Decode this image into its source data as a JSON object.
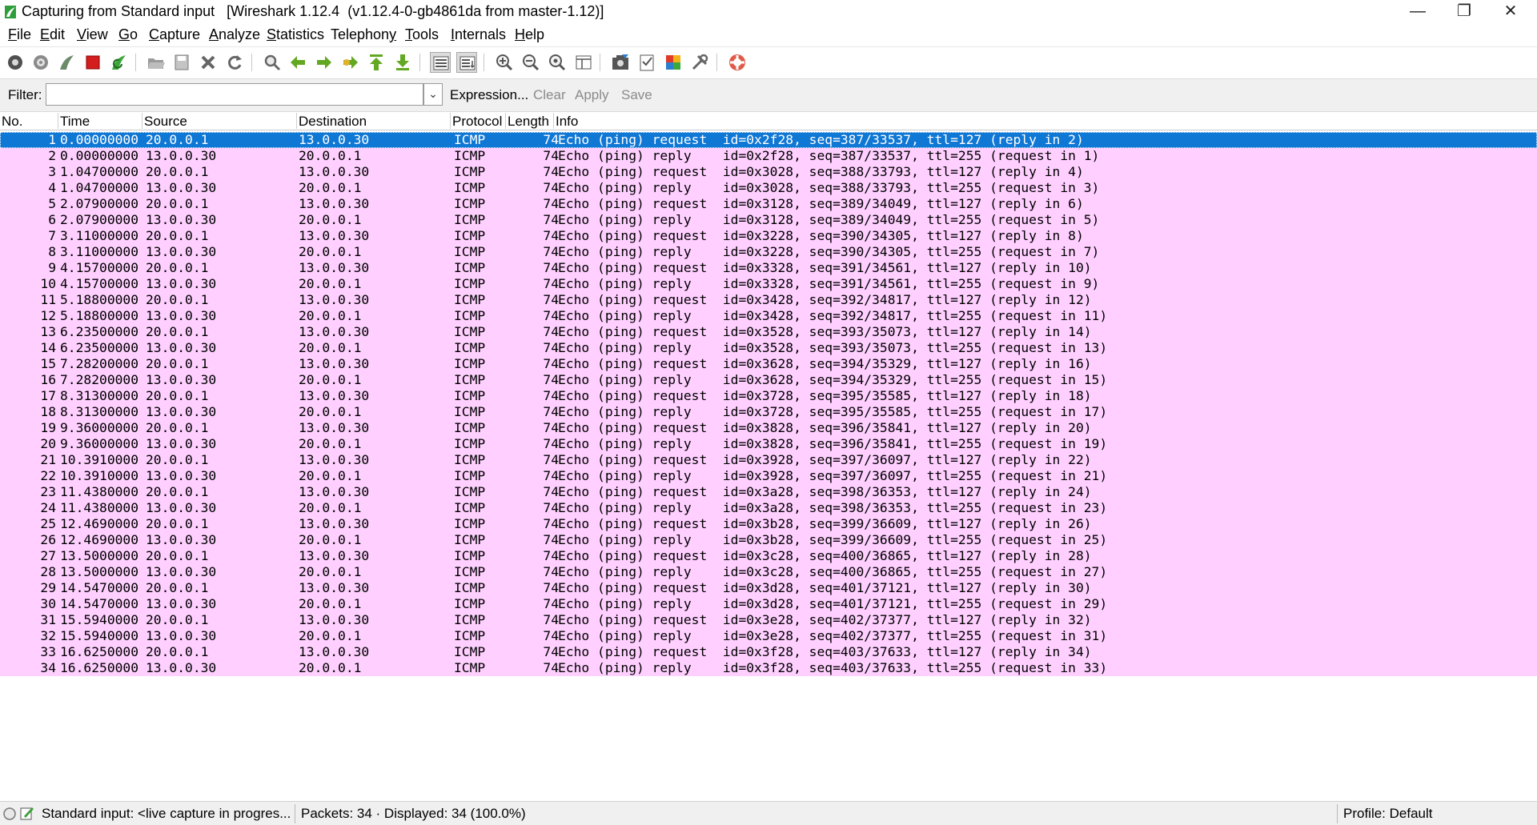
{
  "window": {
    "title": "Capturing from Standard input   [Wireshark 1.12.4  (v1.12.4-0-gb4861da from master-1.12)]",
    "minimize_glyph": "—",
    "restore_glyph": "❐",
    "close_glyph": "✕"
  },
  "menu": [
    {
      "pre": "",
      "key": "F",
      "post": "ile"
    },
    {
      "pre": "",
      "key": "E",
      "post": "dit"
    },
    {
      "pre": "",
      "key": "V",
      "post": "iew"
    },
    {
      "pre": "",
      "key": "G",
      "post": "o"
    },
    {
      "pre": "",
      "key": "C",
      "post": "apture"
    },
    {
      "pre": "",
      "key": "A",
      "post": "nalyze"
    },
    {
      "pre": "",
      "key": "S",
      "post": "tatistics"
    },
    {
      "pre": "Telephon",
      "key": "y",
      "post": ""
    },
    {
      "pre": "",
      "key": "T",
      "post": "ools"
    },
    {
      "pre": "",
      "key": "I",
      "post": "nternals"
    },
    {
      "pre": "",
      "key": "H",
      "post": "elp"
    }
  ],
  "filter": {
    "label": "Filter:",
    "value": "",
    "expression": "Expression...",
    "clear": "Clear",
    "apply": "Apply",
    "save": "Save"
  },
  "columns": {
    "no": "No.",
    "time": "Time",
    "source": "Source",
    "destination": "Destination",
    "protocol": "Protocol",
    "length": "Length",
    "info": "Info"
  },
  "packets": [
    {
      "no": "1",
      "time": "0.00000000",
      "src": "20.0.0.1",
      "dst": "13.0.0.30",
      "proto": "ICMP",
      "len": "74",
      "info": "Echo (ping) request  id=0x2f28, seq=387/33537, ttl=127 (reply in 2)"
    },
    {
      "no": "2",
      "time": "0.00000000",
      "src": "13.0.0.30",
      "dst": "20.0.0.1",
      "proto": "ICMP",
      "len": "74",
      "info": "Echo (ping) reply    id=0x2f28, seq=387/33537, ttl=255 (request in 1)"
    },
    {
      "no": "3",
      "time": "1.04700000",
      "src": "20.0.0.1",
      "dst": "13.0.0.30",
      "proto": "ICMP",
      "len": "74",
      "info": "Echo (ping) request  id=0x3028, seq=388/33793, ttl=127 (reply in 4)"
    },
    {
      "no": "4",
      "time": "1.04700000",
      "src": "13.0.0.30",
      "dst": "20.0.0.1",
      "proto": "ICMP",
      "len": "74",
      "info": "Echo (ping) reply    id=0x3028, seq=388/33793, ttl=255 (request in 3)"
    },
    {
      "no": "5",
      "time": "2.07900000",
      "src": "20.0.0.1",
      "dst": "13.0.0.30",
      "proto": "ICMP",
      "len": "74",
      "info": "Echo (ping) request  id=0x3128, seq=389/34049, ttl=127 (reply in 6)"
    },
    {
      "no": "6",
      "time": "2.07900000",
      "src": "13.0.0.30",
      "dst": "20.0.0.1",
      "proto": "ICMP",
      "len": "74",
      "info": "Echo (ping) reply    id=0x3128, seq=389/34049, ttl=255 (request in 5)"
    },
    {
      "no": "7",
      "time": "3.11000000",
      "src": "20.0.0.1",
      "dst": "13.0.0.30",
      "proto": "ICMP",
      "len": "74",
      "info": "Echo (ping) request  id=0x3228, seq=390/34305, ttl=127 (reply in 8)"
    },
    {
      "no": "8",
      "time": "3.11000000",
      "src": "13.0.0.30",
      "dst": "20.0.0.1",
      "proto": "ICMP",
      "len": "74",
      "info": "Echo (ping) reply    id=0x3228, seq=390/34305, ttl=255 (request in 7)"
    },
    {
      "no": "9",
      "time": "4.15700000",
      "src": "20.0.0.1",
      "dst": "13.0.0.30",
      "proto": "ICMP",
      "len": "74",
      "info": "Echo (ping) request  id=0x3328, seq=391/34561, ttl=127 (reply in 10)"
    },
    {
      "no": "10",
      "time": "4.15700000",
      "src": "13.0.0.30",
      "dst": "20.0.0.1",
      "proto": "ICMP",
      "len": "74",
      "info": "Echo (ping) reply    id=0x3328, seq=391/34561, ttl=255 (request in 9)"
    },
    {
      "no": "11",
      "time": "5.18800000",
      "src": "20.0.0.1",
      "dst": "13.0.0.30",
      "proto": "ICMP",
      "len": "74",
      "info": "Echo (ping) request  id=0x3428, seq=392/34817, ttl=127 (reply in 12)"
    },
    {
      "no": "12",
      "time": "5.18800000",
      "src": "13.0.0.30",
      "dst": "20.0.0.1",
      "proto": "ICMP",
      "len": "74",
      "info": "Echo (ping) reply    id=0x3428, seq=392/34817, ttl=255 (request in 11)"
    },
    {
      "no": "13",
      "time": "6.23500000",
      "src": "20.0.0.1",
      "dst": "13.0.0.30",
      "proto": "ICMP",
      "len": "74",
      "info": "Echo (ping) request  id=0x3528, seq=393/35073, ttl=127 (reply in 14)"
    },
    {
      "no": "14",
      "time": "6.23500000",
      "src": "13.0.0.30",
      "dst": "20.0.0.1",
      "proto": "ICMP",
      "len": "74",
      "info": "Echo (ping) reply    id=0x3528, seq=393/35073, ttl=255 (request in 13)"
    },
    {
      "no": "15",
      "time": "7.28200000",
      "src": "20.0.0.1",
      "dst": "13.0.0.30",
      "proto": "ICMP",
      "len": "74",
      "info": "Echo (ping) request  id=0x3628, seq=394/35329, ttl=127 (reply in 16)"
    },
    {
      "no": "16",
      "time": "7.28200000",
      "src": "13.0.0.30",
      "dst": "20.0.0.1",
      "proto": "ICMP",
      "len": "74",
      "info": "Echo (ping) reply    id=0x3628, seq=394/35329, ttl=255 (request in 15)"
    },
    {
      "no": "17",
      "time": "8.31300000",
      "src": "20.0.0.1",
      "dst": "13.0.0.30",
      "proto": "ICMP",
      "len": "74",
      "info": "Echo (ping) request  id=0x3728, seq=395/35585, ttl=127 (reply in 18)"
    },
    {
      "no": "18",
      "time": "8.31300000",
      "src": "13.0.0.30",
      "dst": "20.0.0.1",
      "proto": "ICMP",
      "len": "74",
      "info": "Echo (ping) reply    id=0x3728, seq=395/35585, ttl=255 (request in 17)"
    },
    {
      "no": "19",
      "time": "9.36000000",
      "src": "20.0.0.1",
      "dst": "13.0.0.30",
      "proto": "ICMP",
      "len": "74",
      "info": "Echo (ping) request  id=0x3828, seq=396/35841, ttl=127 (reply in 20)"
    },
    {
      "no": "20",
      "time": "9.36000000",
      "src": "13.0.0.30",
      "dst": "20.0.0.1",
      "proto": "ICMP",
      "len": "74",
      "info": "Echo (ping) reply    id=0x3828, seq=396/35841, ttl=255 (request in 19)"
    },
    {
      "no": "21",
      "time": "10.3910000",
      "src": "20.0.0.1",
      "dst": "13.0.0.30",
      "proto": "ICMP",
      "len": "74",
      "info": "Echo (ping) request  id=0x3928, seq=397/36097, ttl=127 (reply in 22)"
    },
    {
      "no": "22",
      "time": "10.3910000",
      "src": "13.0.0.30",
      "dst": "20.0.0.1",
      "proto": "ICMP",
      "len": "74",
      "info": "Echo (ping) reply    id=0x3928, seq=397/36097, ttl=255 (request in 21)"
    },
    {
      "no": "23",
      "time": "11.4380000",
      "src": "20.0.0.1",
      "dst": "13.0.0.30",
      "proto": "ICMP",
      "len": "74",
      "info": "Echo (ping) request  id=0x3a28, seq=398/36353, ttl=127 (reply in 24)"
    },
    {
      "no": "24",
      "time": "11.4380000",
      "src": "13.0.0.30",
      "dst": "20.0.0.1",
      "proto": "ICMP",
      "len": "74",
      "info": "Echo (ping) reply    id=0x3a28, seq=398/36353, ttl=255 (request in 23)"
    },
    {
      "no": "25",
      "time": "12.4690000",
      "src": "20.0.0.1",
      "dst": "13.0.0.30",
      "proto": "ICMP",
      "len": "74",
      "info": "Echo (ping) request  id=0x3b28, seq=399/36609, ttl=127 (reply in 26)"
    },
    {
      "no": "26",
      "time": "12.4690000",
      "src": "13.0.0.30",
      "dst": "20.0.0.1",
      "proto": "ICMP",
      "len": "74",
      "info": "Echo (ping) reply    id=0x3b28, seq=399/36609, ttl=255 (request in 25)"
    },
    {
      "no": "27",
      "time": "13.5000000",
      "src": "20.0.0.1",
      "dst": "13.0.0.30",
      "proto": "ICMP",
      "len": "74",
      "info": "Echo (ping) request  id=0x3c28, seq=400/36865, ttl=127 (reply in 28)"
    },
    {
      "no": "28",
      "time": "13.5000000",
      "src": "13.0.0.30",
      "dst": "20.0.0.1",
      "proto": "ICMP",
      "len": "74",
      "info": "Echo (ping) reply    id=0x3c28, seq=400/36865, ttl=255 (request in 27)"
    },
    {
      "no": "29",
      "time": "14.5470000",
      "src": "20.0.0.1",
      "dst": "13.0.0.30",
      "proto": "ICMP",
      "len": "74",
      "info": "Echo (ping) request  id=0x3d28, seq=401/37121, ttl=127 (reply in 30)"
    },
    {
      "no": "30",
      "time": "14.5470000",
      "src": "13.0.0.30",
      "dst": "20.0.0.1",
      "proto": "ICMP",
      "len": "74",
      "info": "Echo (ping) reply    id=0x3d28, seq=401/37121, ttl=255 (request in 29)"
    },
    {
      "no": "31",
      "time": "15.5940000",
      "src": "20.0.0.1",
      "dst": "13.0.0.30",
      "proto": "ICMP",
      "len": "74",
      "info": "Echo (ping) request  id=0x3e28, seq=402/37377, ttl=127 (reply in 32)"
    },
    {
      "no": "32",
      "time": "15.5940000",
      "src": "13.0.0.30",
      "dst": "20.0.0.1",
      "proto": "ICMP",
      "len": "74",
      "info": "Echo (ping) reply    id=0x3e28, seq=402/37377, ttl=255 (request in 31)"
    },
    {
      "no": "33",
      "time": "16.6250000",
      "src": "20.0.0.1",
      "dst": "13.0.0.30",
      "proto": "ICMP",
      "len": "74",
      "info": "Echo (ping) request  id=0x3f28, seq=403/37633, ttl=127 (reply in 34)"
    },
    {
      "no": "34",
      "time": "16.6250000",
      "src": "13.0.0.30",
      "dst": "20.0.0.1",
      "proto": "ICMP",
      "len": "74",
      "info": "Echo (ping) reply    id=0x3f28, seq=403/37633, ttl=255 (request in 33)"
    }
  ],
  "selected_packet": "1",
  "colors": {
    "row_icmp": "#ffd0ff",
    "row_selected": "#0f77d4",
    "app_icon_green": "#2e9e3a",
    "stop_red": "#d41e1e"
  },
  "toolbar_icons": [
    "interfaces-icon",
    "options-icon",
    "start-capture-icon",
    "stop-capture-icon",
    "restart-capture-icon",
    "open-file-icon",
    "save-file-icon",
    "close-file-icon",
    "reload-icon",
    "find-packet-icon",
    "go-back-icon",
    "go-forward-icon",
    "go-to-packet-icon",
    "go-first-icon",
    "go-last-icon",
    "colorize-icon",
    "auto-scroll-icon",
    "zoom-in-icon",
    "zoom-out-icon",
    "normal-size-icon",
    "resize-columns-icon",
    "capture-filters-icon",
    "display-filters-icon",
    "coloring-rules-icon",
    "preferences-icon",
    "help-icon"
  ],
  "status": {
    "capture": "Standard input: <live capture in progres...",
    "packets": "Packets: 34 · Displayed: 34 (100.0%)",
    "profile": "Profile: Default"
  }
}
